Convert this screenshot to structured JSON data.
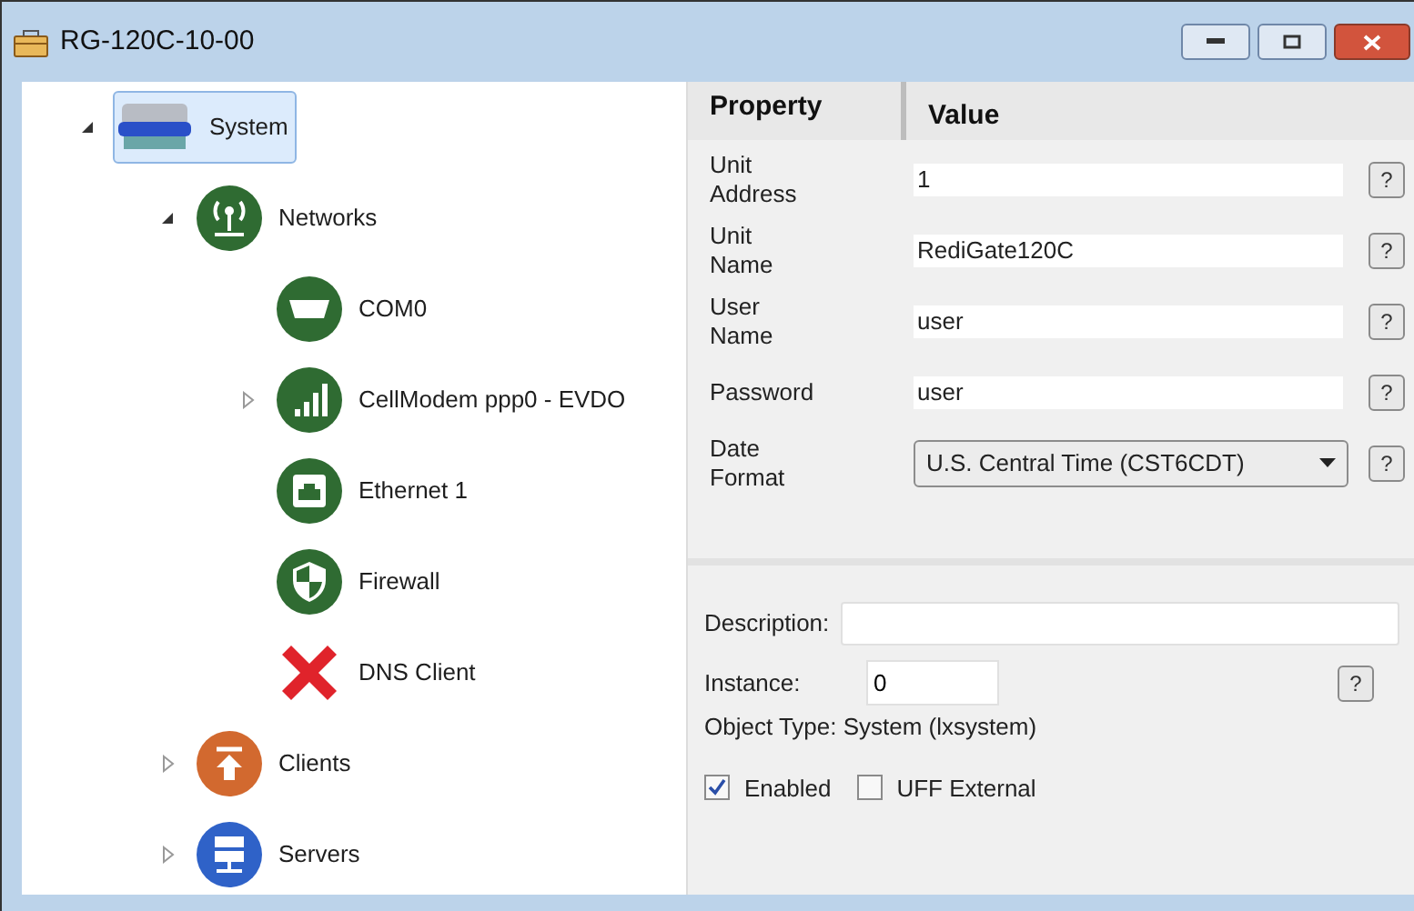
{
  "window": {
    "title": "RG-120C-10-00"
  },
  "tree": [
    {
      "label": "System",
      "selected": true,
      "expanded": true,
      "children": [
        {
          "label": "Networks",
          "selected": false,
          "expanded": true,
          "children": [
            {
              "label": "COM0",
              "selected": false
            },
            {
              "label": "CellModem ppp0 - EVDO",
              "selected": false,
              "expanded": false
            },
            {
              "label": "Ethernet 1",
              "selected": false
            },
            {
              "label": "Firewall",
              "selected": false
            },
            {
              "label": "DNS Client",
              "selected": false
            }
          ]
        },
        {
          "label": "Clients",
          "selected": false,
          "expanded": false
        },
        {
          "label": "Servers",
          "selected": false,
          "expanded": false
        }
      ]
    }
  ],
  "properties": {
    "columns": [
      "Property",
      "Value"
    ],
    "rows": [
      {
        "kind": "text",
        "label": "Unit Address",
        "value": "1",
        "help": "?"
      },
      {
        "kind": "text",
        "label": "Unit Name",
        "value": "RediGate120C",
        "help": "?"
      },
      {
        "kind": "text",
        "label": "User Name",
        "value": "user",
        "help": "?"
      },
      {
        "kind": "text",
        "label": "Password",
        "value": "user",
        "help": "?"
      },
      {
        "kind": "dropdown",
        "label": "Date Format",
        "value": "U.S. Central Time (CST6CDT)",
        "help": "?"
      }
    ]
  },
  "details": {
    "description_label": "Description:",
    "instance_label": "Instance:",
    "instance_value": "0",
    "help": "?",
    "object_type": "Object Type: System (lxsystem)",
    "checkboxes": [
      {
        "label": "Enabled",
        "checked": true
      },
      {
        "label": "UFF External",
        "checked": false
      }
    ]
  }
}
